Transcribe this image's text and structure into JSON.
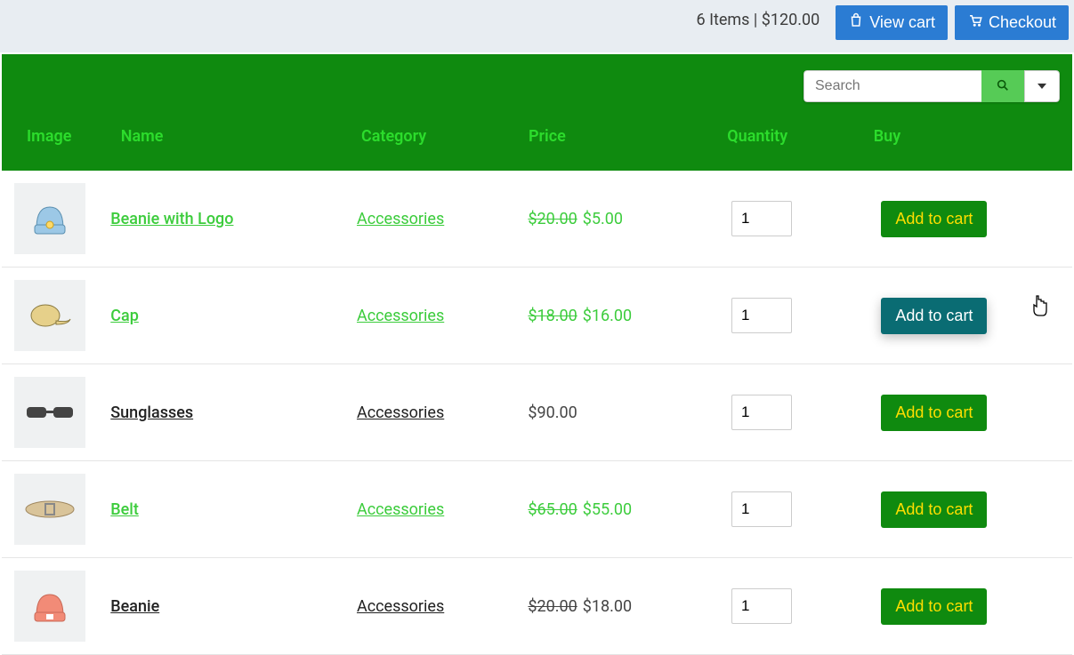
{
  "topbar": {
    "summary": "6 Items | $120.00",
    "view_cart": "View cart",
    "checkout": "Checkout"
  },
  "search": {
    "placeholder": "Search"
  },
  "columns": {
    "image": "Image",
    "name": "Name",
    "category": "Category",
    "price": "Price",
    "quantity": "Quantity",
    "buy": "Buy"
  },
  "buttons": {
    "add_to_cart": "Add to cart"
  },
  "products": [
    {
      "name": "Beanie with Logo",
      "category": "Accessories",
      "old_price": "$20.00",
      "new_price": "$5.00",
      "qty": "1",
      "on_sale": true,
      "variant": "green",
      "hover": false
    },
    {
      "name": "Cap",
      "category": "Accessories",
      "old_price": "$18.00",
      "new_price": "$16.00",
      "qty": "1",
      "on_sale": true,
      "variant": "green",
      "hover": true
    },
    {
      "name": "Sunglasses",
      "category": "Accessories",
      "old_price": null,
      "new_price": "$90.00",
      "qty": "1",
      "on_sale": false,
      "variant": "dark",
      "hover": false
    },
    {
      "name": "Belt",
      "category": "Accessories",
      "old_price": "$65.00",
      "new_price": "$55.00",
      "qty": "1",
      "on_sale": true,
      "variant": "green",
      "hover": false
    },
    {
      "name": "Beanie",
      "category": "Accessories",
      "old_price": "$20.00",
      "new_price": "$18.00",
      "qty": "1",
      "on_sale": true,
      "variant": "dark",
      "hover": false
    }
  ]
}
